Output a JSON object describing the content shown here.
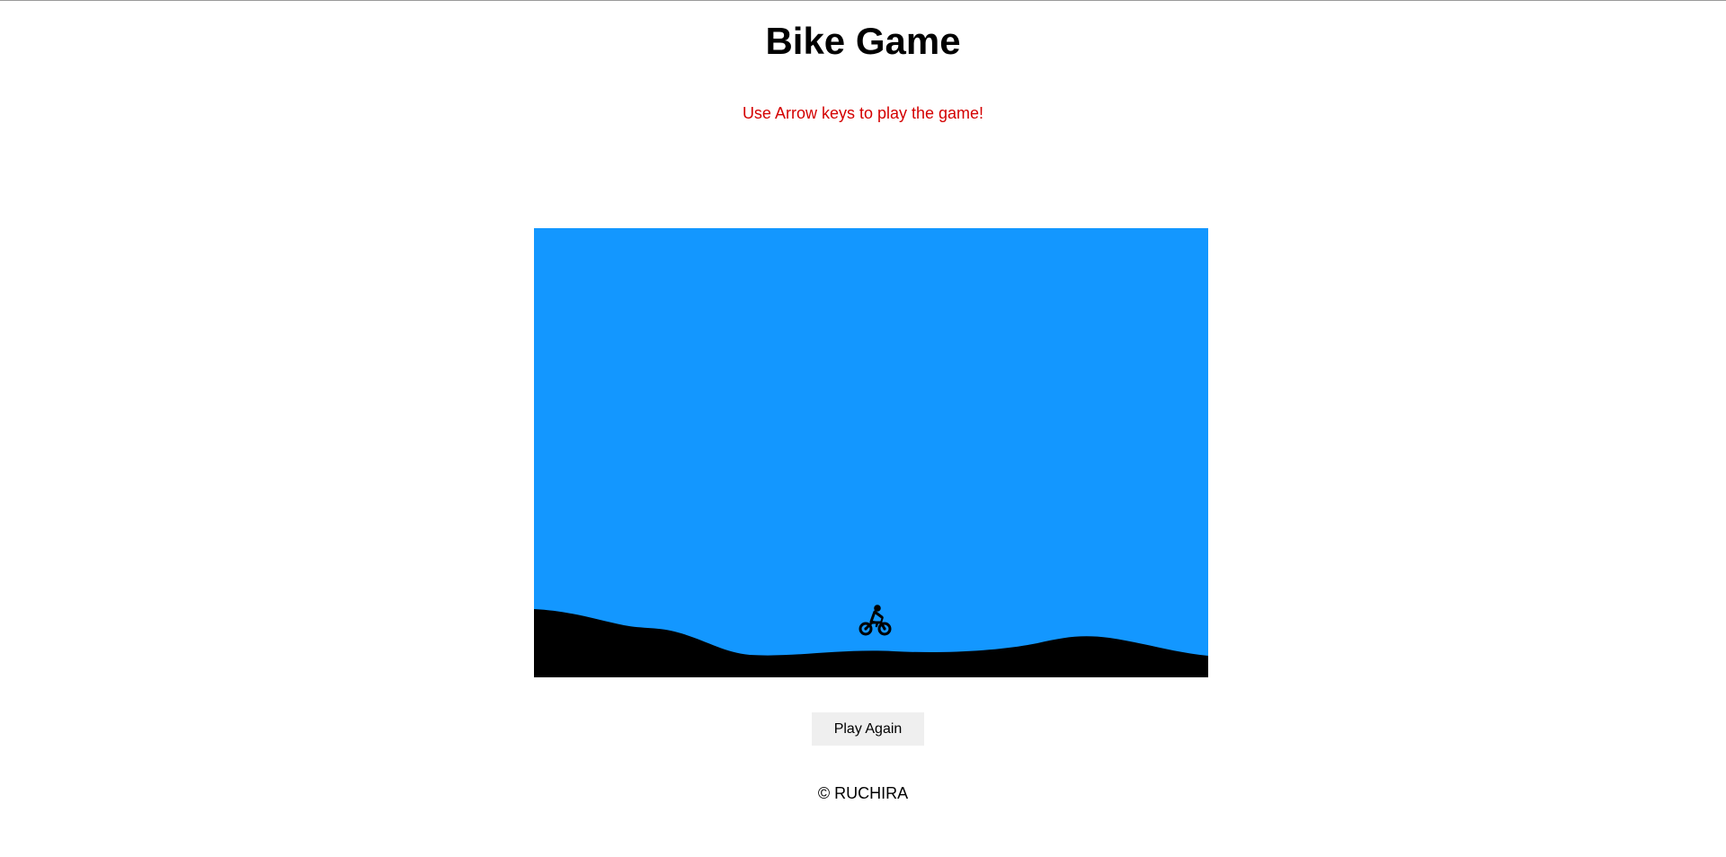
{
  "page": {
    "title": "Bike Game",
    "instructions": "Use Arrow keys to play the game!",
    "play_again_label": "Play Again",
    "footer": "© RUCHIRA"
  },
  "colors": {
    "sky": "#1397ff",
    "ground": "#000000",
    "instructions_text": "#d40000",
    "button_bg": "#efefef"
  },
  "game": {
    "player_icon": "motorbike-rider-icon",
    "controls": "arrow-keys"
  }
}
